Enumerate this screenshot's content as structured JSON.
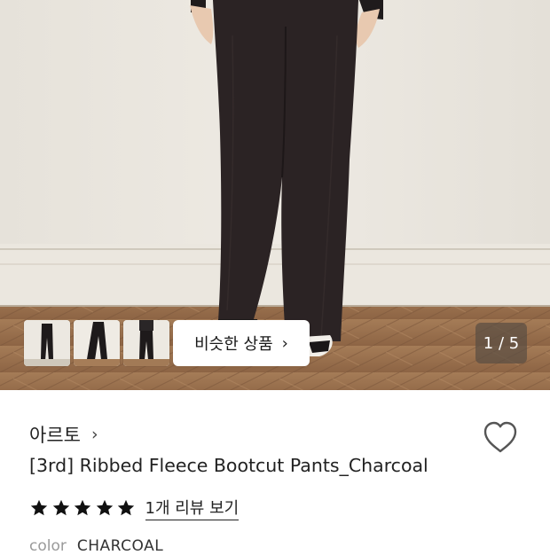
{
  "gallery": {
    "similar_label": "비슷한 상품",
    "similar_chevron": "›",
    "counter": "1 / 5",
    "thumbnail_count": 3
  },
  "product": {
    "brand": "아르토",
    "brand_chevron": "›",
    "title": "[3rd] Ribbed Fleece Bootcut Pants_Charcoal",
    "rating_stars": 5,
    "reviews_label": "1개 리뷰 보기",
    "color_label": "color",
    "color_value": "CHARCOAL"
  },
  "icons": {
    "heart": "heart-outline-icon",
    "star": "star-filled-icon",
    "chevron": "chevron-right-icon"
  },
  "colors": {
    "pants": "#2b2324",
    "wall": "#e9e5dd",
    "floor": "#9a7150",
    "text": "#222222"
  }
}
